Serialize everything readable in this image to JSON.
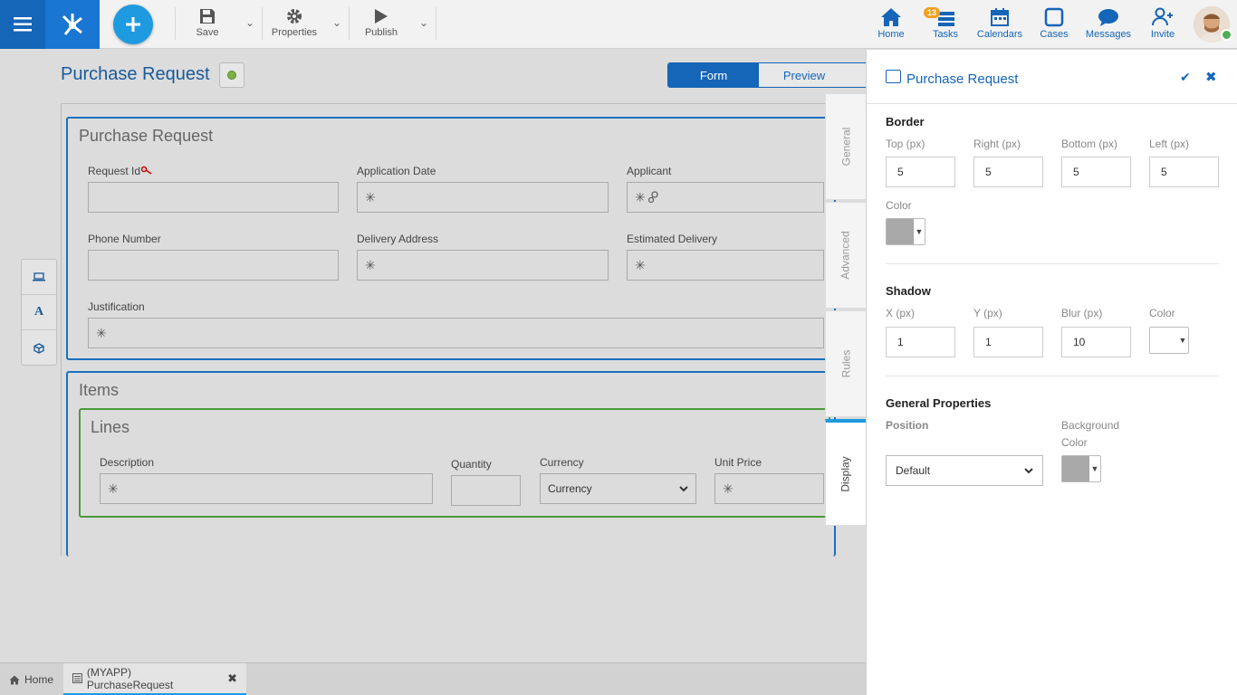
{
  "toolbar": {
    "save_label": "Save",
    "properties_label": "Properties",
    "publish_label": "Publish"
  },
  "nav": {
    "home": "Home",
    "tasks": "Tasks",
    "tasks_badge": "13",
    "calendars": "Calendars",
    "cases": "Cases",
    "messages": "Messages",
    "invite": "Invite"
  },
  "page": {
    "title": "Purchase Request",
    "view_tabs": [
      "Form",
      "Preview"
    ]
  },
  "form": {
    "section1_title": "Purchase Request",
    "labels": {
      "request_id": "Request Id",
      "application_date": "Application Date",
      "applicant": "Applicant",
      "phone_number": "Phone Number",
      "delivery_address": "Delivery Address",
      "estimated_delivery": "Estimated Delivery",
      "justification": "Justification"
    },
    "section2_title": "Items",
    "lines_title": "Lines",
    "line_labels": {
      "description": "Description",
      "quantity": "Quantity",
      "currency": "Currency",
      "unit_price": "Unit Price"
    },
    "currency_value": "Currency"
  },
  "vtabs": [
    "General",
    "Advanced",
    "Rules",
    "Display"
  ],
  "panel": {
    "title": "Purchase Request",
    "border": {
      "heading": "Border",
      "top_label": "Top (px)",
      "top": "5",
      "right_label": "Right (px)",
      "right": "5",
      "bottom_label": "Bottom (px)",
      "bottom": "5",
      "left_label": "Left (px)",
      "left": "5",
      "color_label": "Color"
    },
    "shadow": {
      "heading": "Shadow",
      "x_label": "X (px)",
      "x": "1",
      "y_label": "Y (px)",
      "y": "1",
      "blur_label": "Blur (px)",
      "blur": "10",
      "color_label": "Color"
    },
    "general": {
      "heading": "General Properties",
      "position_label": "Position",
      "position_value": "Default",
      "bg_label_1": "Background",
      "bg_label_2": "Color"
    }
  },
  "bottom_tabs": {
    "home": "Home",
    "doc": "(MYAPP) PurchaseRequest"
  },
  "colors": {
    "primary": "#1565b8",
    "accent": "#1e9ae0",
    "status": "#7cb342",
    "badge": "#f0a020"
  }
}
